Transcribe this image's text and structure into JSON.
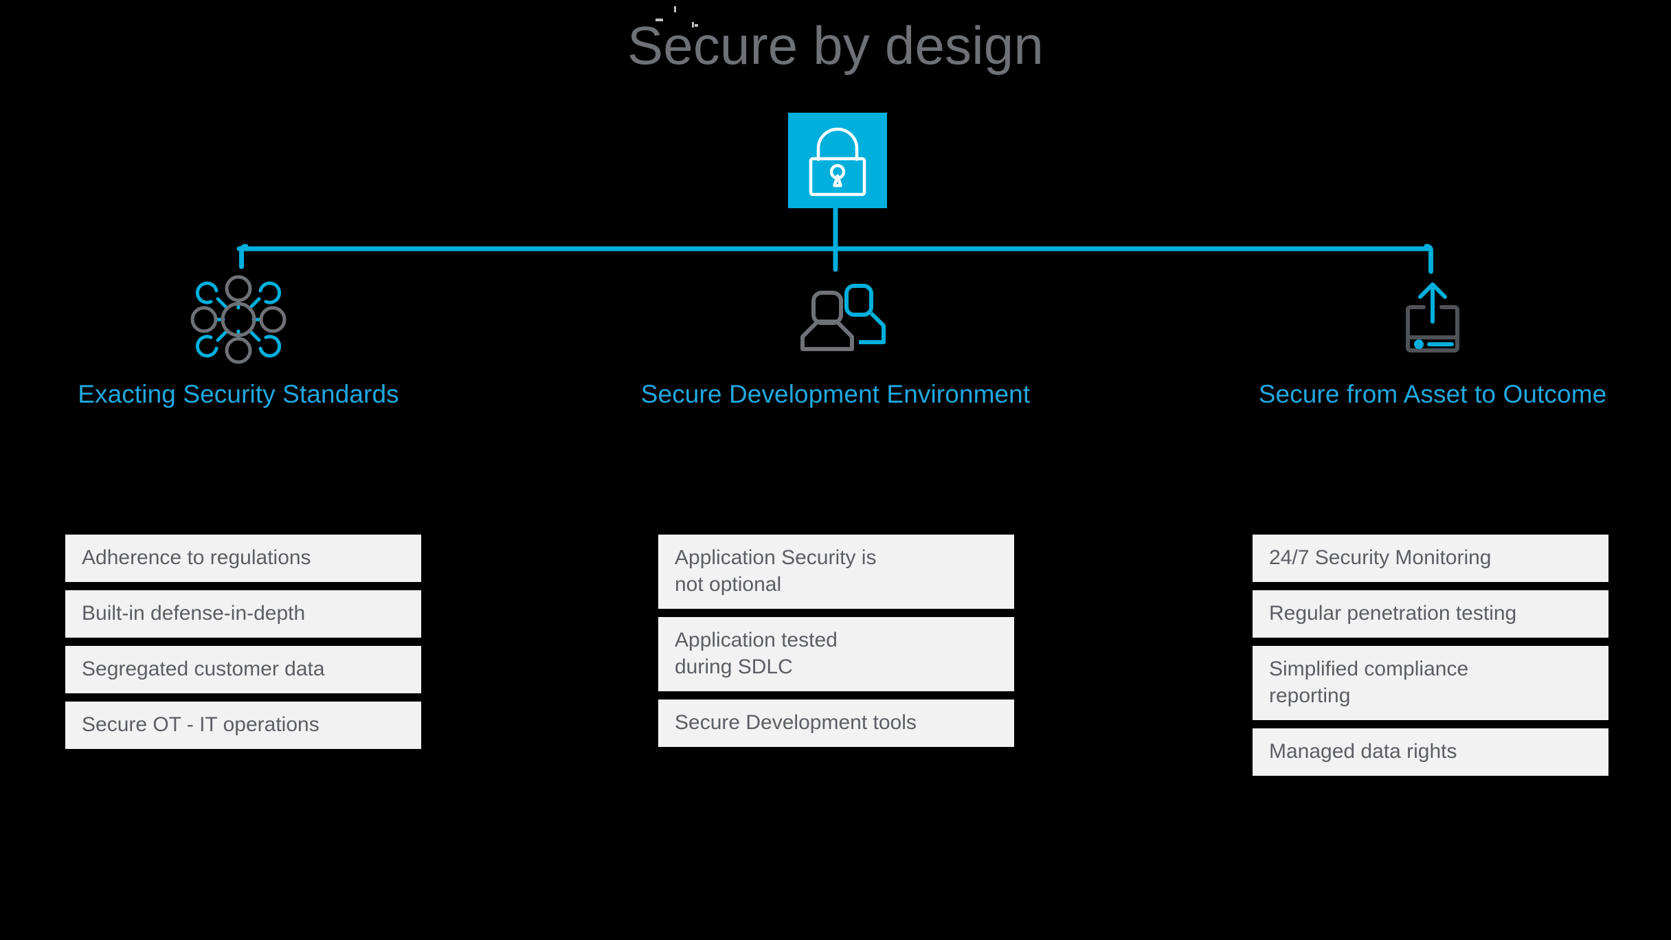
{
  "page": {
    "title": "Secure by design",
    "background_color": "#000000",
    "accent_color": "#00AFDC",
    "title_color": "#6E7176",
    "heading_color": "#21A8E0",
    "box_background_color": "#F3F2F3",
    "box_text_color": "#5B5E63"
  },
  "hub": {
    "icon": "padlock-icon",
    "badge_color": "#00AFDC"
  },
  "columns": [
    {
      "icon": "network-hub-icon",
      "title": "Exacting Security\nStandards",
      "items": [
        "Adherence to regulations",
        "Built-in defense-in-depth",
        "Segregated customer data",
        "Secure OT - IT operations"
      ]
    },
    {
      "icon": "users-icon",
      "title": "Secure Development\nEnvironment",
      "items": [
        "Application Security is\nnot optional",
        "Application tested\nduring SDLC",
        "Secure Development tools"
      ]
    },
    {
      "icon": "upload-device-icon",
      "title": "Secure from Asset\nto Outcome",
      "items": [
        "24/7 Security Monitoring",
        "Regular penetration testing",
        "Simplified compliance\nreporting",
        "Managed data rights"
      ]
    }
  ]
}
